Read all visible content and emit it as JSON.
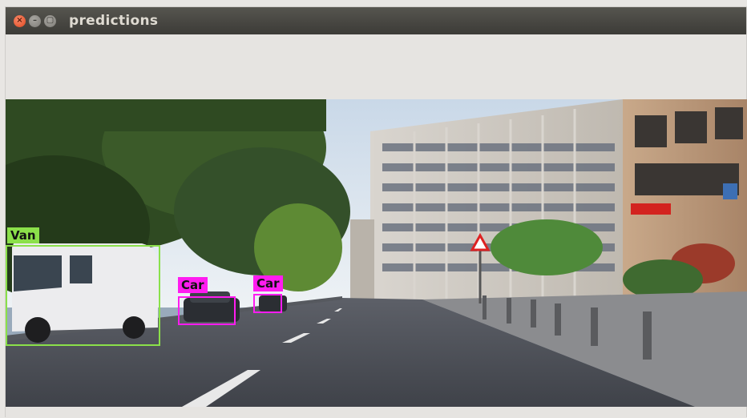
{
  "window": {
    "title": "predictions",
    "controls": {
      "close": "×",
      "minimize": "–",
      "maximize": "▢"
    }
  },
  "detections": [
    {
      "label": "Van",
      "color": "#8be04a"
    },
    {
      "label": "Car",
      "color": "#ff1cf0"
    },
    {
      "label": "Car",
      "color": "#ff1cf0"
    }
  ]
}
